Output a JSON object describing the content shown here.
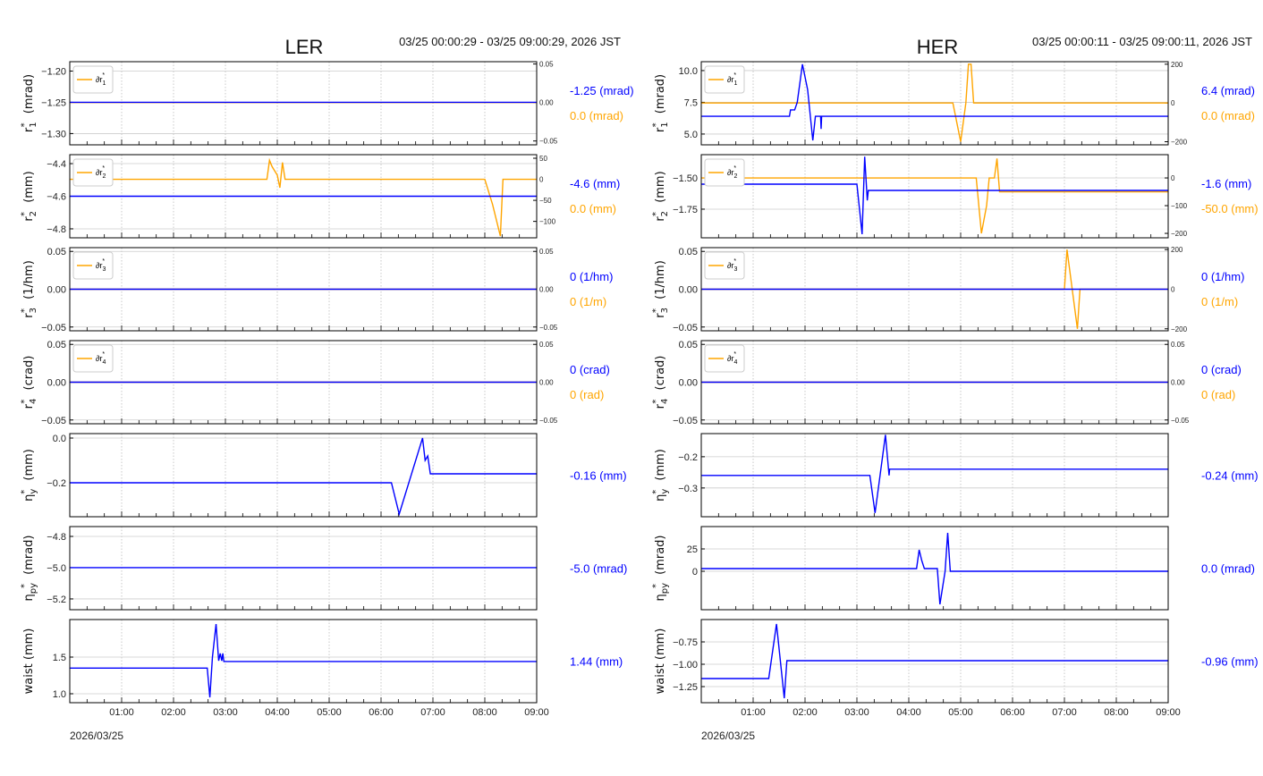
{
  "chart_data": [
    {
      "type": "line",
      "title": "LER",
      "range": "03/25 00:00:29 - 03/25 09:00:29, 2026 JST",
      "date_label": "2026/03/25",
      "xlim": [
        0,
        9
      ],
      "xticks": [
        "01:00",
        "02:00",
        "03:00",
        "04:00",
        "05:00",
        "06:00",
        "07:00",
        "08:00",
        "09:00"
      ],
      "rows": [
        {
          "ylabel": {
            "sym": "r",
            "sub": "1",
            "unit": "(mrad)"
          },
          "ylim": [
            -1.318,
            -1.185
          ],
          "yticks": [
            -1.2,
            -1.25,
            -1.3
          ],
          "ydec": 2,
          "ylim2": [
            -0.055,
            0.053
          ],
          "yticks2": [
            0.05,
            0,
            -0.05
          ],
          "ydec2": 2,
          "legend": "∂r",
          "legend_sub": "1",
          "blue": [
            [
              0,
              -1.25
            ],
            [
              9,
              -1.25
            ]
          ],
          "orange": [
            [
              0,
              0
            ],
            [
              9,
              0
            ]
          ],
          "value_blue": "-1.25 (mrad)",
          "value_orange": "0.0 (mrad)"
        },
        {
          "ylabel": {
            "sym": "r",
            "sub": "2",
            "unit": "(mm)"
          },
          "ylim": [
            -4.855,
            -4.345
          ],
          "yticks": [
            -4.4,
            -4.6,
            -4.8
          ],
          "ydec": 1,
          "ylim2": [
            -139,
            58.5
          ],
          "yticks2": [
            50,
            0,
            -50,
            -100
          ],
          "ydec2": 0,
          "legend": "∂r",
          "legend_sub": "2",
          "blue": [
            [
              0,
              -4.6
            ],
            [
              9,
              -4.6
            ]
          ],
          "orange": [
            [
              0,
              0
            ],
            [
              3.8,
              0
            ],
            [
              3.85,
              45
            ],
            [
              3.9,
              30
            ],
            [
              4.0,
              10
            ],
            [
              4.05,
              -20
            ],
            [
              4.1,
              40
            ],
            [
              4.15,
              0
            ],
            [
              8.0,
              0
            ],
            [
              8.15,
              -60
            ],
            [
              8.3,
              -135
            ],
            [
              8.35,
              0
            ],
            [
              9,
              0
            ]
          ],
          "value_blue": "-4.6 (mm)",
          "value_orange": "0.0 (mm)"
        },
        {
          "ylabel": {
            "sym": "r",
            "sub": "3",
            "unit": "(1/hm)"
          },
          "ylim": [
            -0.055,
            0.055
          ],
          "yticks": [
            0.05,
            0,
            -0.05
          ],
          "ydec": 2,
          "ylim2": [
            -0.055,
            0.055
          ],
          "yticks2": [
            0.05,
            0,
            -0.05
          ],
          "ydec2": 2,
          "legend": "∂r",
          "legend_sub": "3",
          "blue": [
            [
              0,
              0
            ],
            [
              9,
              0
            ]
          ],
          "orange": [
            [
              0,
              0
            ],
            [
              9,
              0
            ]
          ],
          "value_blue": "0 (1/hm)",
          "value_orange": "0 (1/m)"
        },
        {
          "ylabel": {
            "sym": "r",
            "sub": "4",
            "unit": "(crad)"
          },
          "ylim": [
            -0.055,
            0.055
          ],
          "yticks": [
            0.05,
            0,
            -0.05
          ],
          "ydec": 2,
          "ylim2": [
            -0.055,
            0.055
          ],
          "yticks2": [
            0.05,
            0,
            -0.05
          ],
          "ydec2": 2,
          "legend": "∂r",
          "legend_sub": "4",
          "blue": [
            [
              0,
              0
            ],
            [
              9,
              0
            ]
          ],
          "orange": [
            [
              0,
              0
            ],
            [
              9,
              0
            ]
          ],
          "value_blue": "0 (crad)",
          "value_orange": "0 (rad)"
        },
        {
          "ylabel": {
            "sym": "η",
            "sub": "y",
            "unit": "(mm)"
          },
          "ylim": [
            -0.352,
            0.02
          ],
          "yticks": [
            0.0,
            -0.2
          ],
          "ydec": 1,
          "blue": [
            [
              0,
              -0.2
            ],
            [
              6.2,
              -0.2
            ],
            [
              6.35,
              -0.34
            ],
            [
              6.8,
              0.0
            ],
            [
              6.85,
              -0.1
            ],
            [
              6.9,
              -0.08
            ],
            [
              6.95,
              -0.16
            ],
            [
              9,
              -0.16
            ]
          ],
          "value_blue": "-0.16 (mm)"
        },
        {
          "ylabel": {
            "sym": "η",
            "sub": "py",
            "unit": "(mrad)"
          },
          "ylim": [
            -5.269,
            -4.737
          ],
          "yticks": [
            -4.8,
            -5.0,
            -5.2
          ],
          "ydec": 1,
          "blue": [
            [
              0,
              -5.0
            ],
            [
              9,
              -5.0
            ]
          ],
          "value_blue": "-5.0 (mrad)"
        },
        {
          "ylabel": {
            "sym": "waist",
            "sub": "",
            "unit": "(mm)"
          },
          "ylim": [
            0.878,
            2.012
          ],
          "yticks": [
            1.5,
            1.0
          ],
          "ydec": 1,
          "blue": [
            [
              0,
              1.35
            ],
            [
              2.65,
              1.35
            ],
            [
              2.7,
              0.95
            ],
            [
              2.75,
              1.5
            ],
            [
              2.82,
              1.95
            ],
            [
              2.87,
              1.45
            ],
            [
              2.9,
              1.55
            ],
            [
              2.93,
              1.45
            ],
            [
              2.95,
              1.55
            ],
            [
              2.97,
              1.44
            ],
            [
              9,
              1.44
            ]
          ],
          "value_blue": "1.44 (mm)"
        }
      ]
    },
    {
      "type": "line",
      "title": "HER",
      "range": "03/25 00:00:11 - 03/25 09:00:11, 2026 JST",
      "date_label": "2026/03/25",
      "xlim": [
        0,
        9
      ],
      "xticks": [
        "01:00",
        "02:00",
        "03:00",
        "04:00",
        "05:00",
        "06:00",
        "07:00",
        "08:00",
        "09:00"
      ],
      "rows": [
        {
          "ylabel": {
            "sym": "r",
            "sub": "1",
            "unit": "(mrad)"
          },
          "ylim": [
            4.15,
            10.7
          ],
          "yticks": [
            10.0,
            7.5,
            5.0
          ],
          "ydec": 1,
          "ylim2": [
            -216,
            213
          ],
          "yticks2": [
            200,
            0,
            -200
          ],
          "ydec2": 0,
          "legend": "∂r",
          "legend_sub": "1",
          "blue": [
            [
              0,
              6.4
            ],
            [
              1.7,
              6.4
            ],
            [
              1.72,
              6.9
            ],
            [
              1.8,
              6.9
            ],
            [
              1.85,
              7.5
            ],
            [
              1.95,
              10.5
            ],
            [
              2.05,
              8.5
            ],
            [
              2.15,
              4.5
            ],
            [
              2.2,
              6.4
            ],
            [
              2.3,
              6.4
            ],
            [
              2.31,
              5.4
            ],
            [
              2.32,
              6.4
            ],
            [
              9,
              6.4
            ]
          ],
          "orange": [
            [
              0,
              0
            ],
            [
              4.85,
              0
            ],
            [
              5.0,
              -200
            ],
            [
              5.1,
              0
            ],
            [
              5.15,
              200
            ],
            [
              5.2,
              200
            ],
            [
              5.25,
              0
            ],
            [
              9,
              0
            ]
          ],
          "value_blue": "6.4 (mrad)",
          "value_orange": "0.0 (mrad)"
        },
        {
          "ylabel": {
            "sym": "r",
            "sub": "2",
            "unit": "(mm)"
          },
          "ylim": [
            -1.979,
            -1.314
          ],
          "yticks": [
            -1.5,
            -1.75
          ],
          "ydec": 2,
          "ylim2": [
            -216,
            84
          ],
          "yticks2": [
            0,
            -100,
            -200
          ],
          "ydec2": 0,
          "legend": "∂r",
          "legend_sub": "2",
          "blue": [
            [
              0,
              -1.55
            ],
            [
              3.0,
              -1.55
            ],
            [
              3.05,
              -1.75
            ],
            [
              3.1,
              -1.95
            ],
            [
              3.15,
              -1.33
            ],
            [
              3.2,
              -1.68
            ],
            [
              3.22,
              -1.6
            ],
            [
              9,
              -1.6
            ]
          ],
          "orange": [
            [
              0,
              0
            ],
            [
              5.3,
              0
            ],
            [
              5.4,
              -200
            ],
            [
              5.5,
              -100
            ],
            [
              5.55,
              0
            ],
            [
              5.65,
              0
            ],
            [
              5.7,
              70
            ],
            [
              5.75,
              -50
            ],
            [
              9,
              -50
            ]
          ],
          "value_blue": "-1.6 (mm)",
          "value_orange": "-50.0 (mm)"
        },
        {
          "ylabel": {
            "sym": "r",
            "sub": "3",
            "unit": "(1/hm)"
          },
          "ylim": [
            -0.055,
            0.055
          ],
          "yticks": [
            0.05,
            0,
            -0.05
          ],
          "ydec": 2,
          "ylim2": [
            -210,
            210
          ],
          "yticks2": [
            200,
            0,
            -200
          ],
          "ydec2": 0,
          "legend": "∂r",
          "legend_sub": "3",
          "blue": [
            [
              0,
              0
            ],
            [
              9,
              0
            ]
          ],
          "orange": [
            [
              0,
              0
            ],
            [
              7.0,
              0
            ],
            [
              7.05,
              200
            ],
            [
              7.1,
              100
            ],
            [
              7.25,
              -200
            ],
            [
              7.3,
              0
            ],
            [
              9,
              0
            ]
          ],
          "value_blue": "0 (1/hm)",
          "value_orange": "0 (1/m)"
        },
        {
          "ylabel": {
            "sym": "r",
            "sub": "4",
            "unit": "(crad)"
          },
          "ylim": [
            -0.055,
            0.055
          ],
          "yticks": [
            0.05,
            0,
            -0.05
          ],
          "ydec": 2,
          "ylim2": [
            -0.055,
            0.055
          ],
          "yticks2": [
            0.05,
            0,
            -0.05
          ],
          "ydec2": 2,
          "legend": "∂r",
          "legend_sub": "4",
          "blue": [
            [
              0,
              0
            ],
            [
              9,
              0
            ]
          ],
          "orange": [
            [
              0,
              0
            ],
            [
              9,
              0
            ]
          ],
          "value_blue": "0 (crad)",
          "value_orange": "0 (rad)"
        },
        {
          "ylabel": {
            "sym": "η",
            "sub": "y",
            "unit": "(mm)"
          },
          "ylim": [
            -0.392,
            -0.126
          ],
          "yticks": [
            -0.2,
            -0.3
          ],
          "ydec": 1,
          "blue": [
            [
              0,
              -0.26
            ],
            [
              3.25,
              -0.26
            ],
            [
              3.35,
              -0.38
            ],
            [
              3.55,
              -0.13
            ],
            [
              3.62,
              -0.26
            ],
            [
              3.63,
              -0.24
            ],
            [
              9,
              -0.24
            ]
          ],
          "value_blue": "-0.24 (mm)"
        },
        {
          "ylabel": {
            "sym": "η",
            "sub": "py",
            "unit": "(mrad)"
          },
          "ylim": [
            -43,
            50
          ],
          "yticks": [
            25,
            0
          ],
          "ydec": 0,
          "blue": [
            [
              0,
              3
            ],
            [
              4.15,
              3
            ],
            [
              4.2,
              24
            ],
            [
              4.25,
              12
            ],
            [
              4.3,
              3
            ],
            [
              4.55,
              3
            ],
            [
              4.6,
              -37
            ],
            [
              4.7,
              0
            ],
            [
              4.75,
              43
            ],
            [
              4.8,
              0
            ],
            [
              9,
              0
            ]
          ],
          "value_blue": "0.0 (mrad)"
        },
        {
          "ylabel": {
            "sym": "waist",
            "sub": "",
            "unit": "(mm)"
          },
          "ylim": [
            -1.43,
            -0.5
          ],
          "yticks": [
            -0.75,
            -1.0,
            -1.25
          ],
          "ydec": 2,
          "blue": [
            [
              0,
              -1.16
            ],
            [
              1.3,
              -1.16
            ],
            [
              1.45,
              -0.55
            ],
            [
              1.6,
              -1.38
            ],
            [
              1.65,
              -0.96
            ],
            [
              9,
              -0.96
            ]
          ],
          "value_blue": "-0.96 (mm)"
        }
      ]
    }
  ],
  "colors": {
    "blue": "#0000ff",
    "orange": "#ffa500",
    "grid": "#cccccc"
  }
}
